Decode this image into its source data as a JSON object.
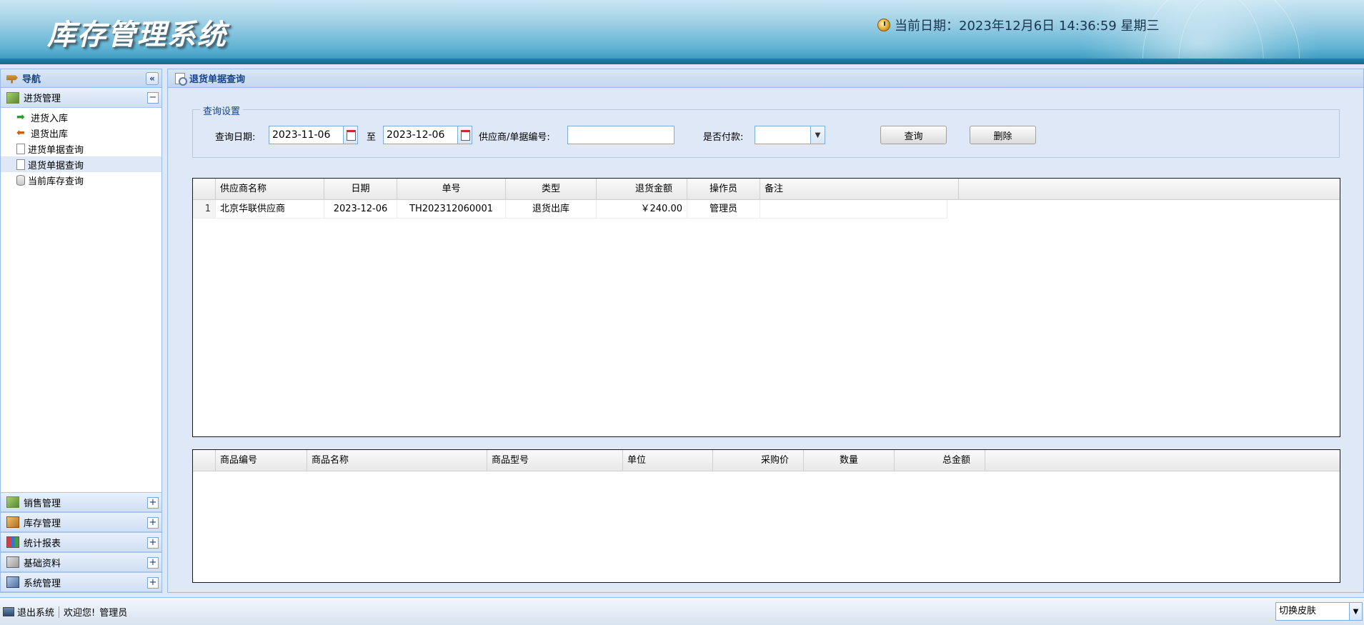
{
  "header": {
    "app_title": "库存管理系统",
    "datetime": "当前日期：2023年12月6日 14:36:59 星期三"
  },
  "sidebar": {
    "title": "导航",
    "collapse_label": "«",
    "groups_top": {
      "label": "进货管理",
      "toggle": "−",
      "items": [
        {
          "label": "进货入库"
        },
        {
          "label": "退货出库"
        },
        {
          "label": "进货单据查询"
        },
        {
          "label": "退货单据查询"
        },
        {
          "label": "当前库存查询"
        }
      ]
    },
    "groups_bottom": [
      {
        "label": "销售管理",
        "toggle": "+"
      },
      {
        "label": "库存管理",
        "toggle": "+"
      },
      {
        "label": "统计报表",
        "toggle": "+"
      },
      {
        "label": "基础资料",
        "toggle": "+"
      },
      {
        "label": "系统管理",
        "toggle": "+"
      }
    ]
  },
  "main": {
    "title": "退货单据查询",
    "query": {
      "legend": "查询设置",
      "date_label": "查询日期:",
      "date_from": "2023-11-06",
      "to_label": "至",
      "date_to": "2023-12-06",
      "supplier_label": "供应商/单据编号:",
      "supplier_value": "",
      "paid_label": "是否付款:",
      "paid_value": "",
      "query_button": "查询",
      "delete_button": "删除"
    },
    "top_grid": {
      "columns": [
        "供应商名称",
        "日期",
        "单号",
        "类型",
        "退货金额",
        "操作员",
        "备注"
      ],
      "rows": [
        {
          "num": "1",
          "supplier": "北京华联供应商",
          "date": "2023-12-06",
          "number": "TH202312060001",
          "type": "退货出库",
          "amount": "￥240.00",
          "operator": "管理员",
          "remark": ""
        }
      ]
    },
    "bottom_grid": {
      "columns": [
        "商品编号",
        "商品名称",
        "商品型号",
        "单位",
        "采购价",
        "数量",
        "总金额"
      ]
    }
  },
  "statusbar": {
    "logout": "退出系统",
    "welcome": "欢迎您!",
    "user": "管理员",
    "skin_label": "切换皮肤"
  },
  "colors": {
    "accent": "#15428b",
    "panel_border": "#99bbe8",
    "panel_bg": "#dfe8f6"
  }
}
